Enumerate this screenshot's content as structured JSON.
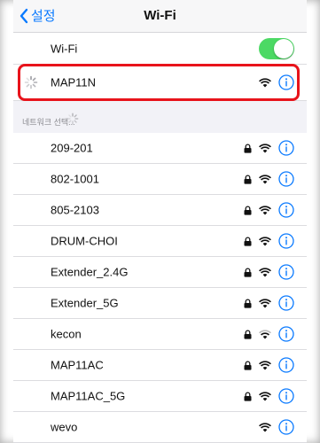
{
  "nav": {
    "back_label": "설정",
    "title": "Wi-Fi"
  },
  "wifi_toggle": {
    "label": "Wi-Fi",
    "on": true
  },
  "connected": {
    "name": "MAP11N"
  },
  "section": {
    "header": "네트워크 선택..."
  },
  "networks": [
    {
      "name": "209-201",
      "secured": true
    },
    {
      "name": "802-1001",
      "secured": true
    },
    {
      "name": "805-2103",
      "secured": true
    },
    {
      "name": "DRUM-CHOI",
      "secured": true
    },
    {
      "name": "Extender_2.4G",
      "secured": true
    },
    {
      "name": "Extender_5G",
      "secured": true
    },
    {
      "name": "kecon",
      "secured": true
    },
    {
      "name": "MAP11AC",
      "secured": true
    },
    {
      "name": "MAP11AC_5G",
      "secured": true
    },
    {
      "name": "wevo",
      "secured": false
    }
  ],
  "colors": {
    "accent": "#0a7aff",
    "toggle_on": "#4cd964",
    "highlight": "#e8131b"
  },
  "icons": {
    "back": "chevron-left-icon",
    "spinner": "activity-spinner-icon",
    "lock": "lock-icon",
    "wifi": "wifi-signal-icon",
    "info": "info-circle-icon"
  }
}
